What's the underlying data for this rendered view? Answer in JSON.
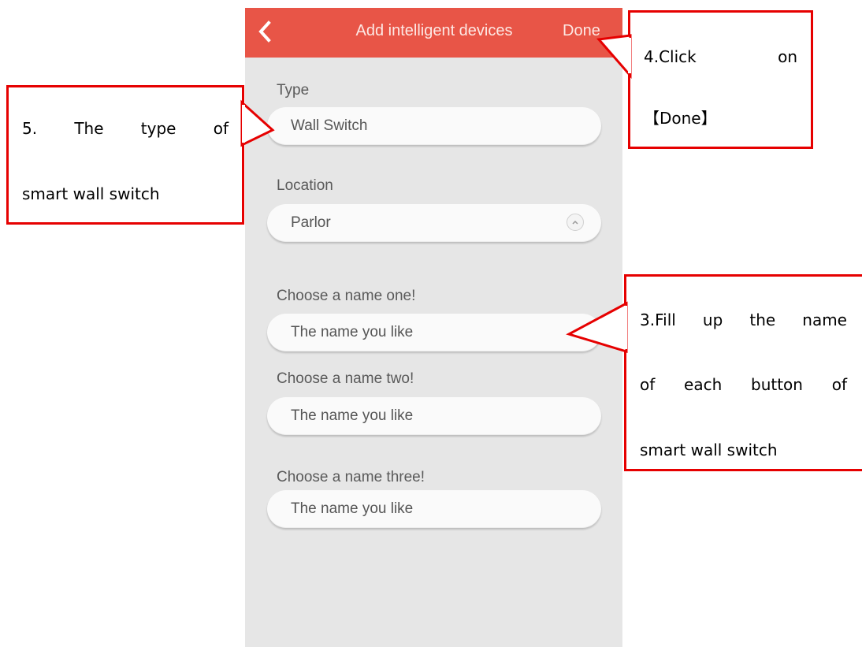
{
  "header": {
    "title": "Add intelligent devices",
    "done_label": "Done",
    "back_icon": "chevron-left-icon",
    "color": "#e85547"
  },
  "form": {
    "type": {
      "label": "Type",
      "value": "Wall Switch"
    },
    "location": {
      "label": "Location",
      "value": "Parlor",
      "icon": "chevron-up-icon"
    },
    "name_one": {
      "label": "Choose a name one!",
      "placeholder": "The name you like"
    },
    "name_two": {
      "label": "Choose a name two!",
      "placeholder": "The name you like"
    },
    "name_three": {
      "label": "Choose a name three!",
      "placeholder": "The name you like"
    }
  },
  "callouts": {
    "step3": {
      "lines": [
        "3.Fill up the name",
        "of each button of",
        "smart wall switch"
      ]
    },
    "step4": {
      "lines": [
        "4.Click on",
        "【Done】"
      ]
    },
    "step5": {
      "lines": [
        "5. The type of",
        "smart wall switch"
      ]
    },
    "border_color": "#e60000"
  }
}
